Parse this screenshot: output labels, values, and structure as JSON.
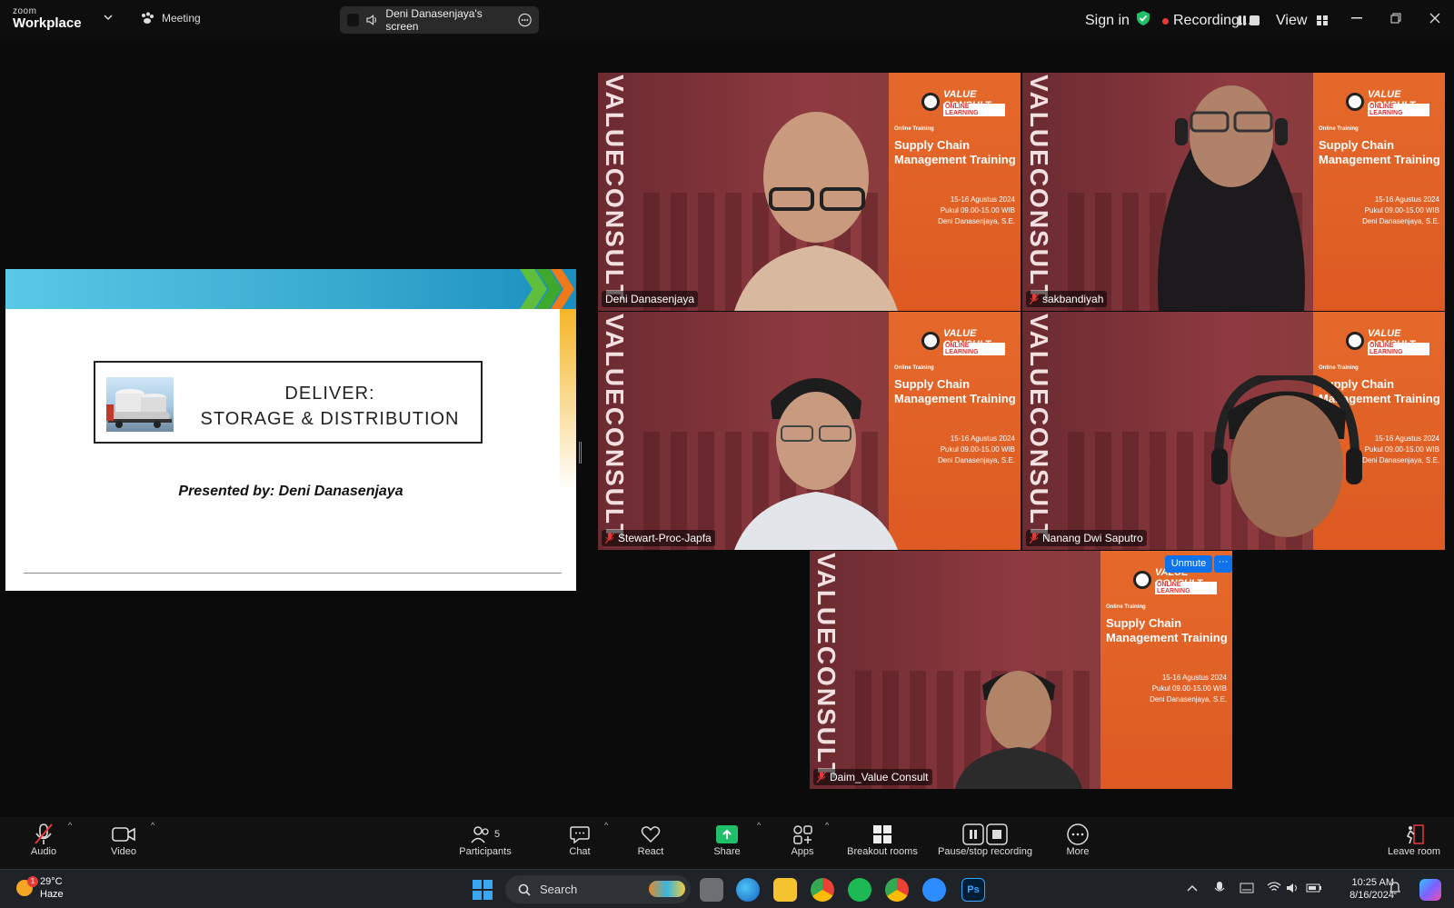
{
  "app": {
    "brand_small": "zoom",
    "brand_large": "Workplace",
    "meeting_label": "Meeting",
    "screen_share_label": "Deni Danasenjaya's screen"
  },
  "topbar_right": {
    "sign_in": "Sign in",
    "recording_label": "Recording...",
    "view_label": "View"
  },
  "slide": {
    "title_line1": "DELIVER:",
    "title_line2": "STORAGE & DISTRIBUTION",
    "presented_by": "Presented by: Deni Danasenjaya"
  },
  "tile_banner": {
    "logo_text": "VALUE CONSULT",
    "online_learning": "ONLINE LEARNING",
    "online_training": "Online Training",
    "title_line1": "Supply Chain",
    "title_line2": "Management Training",
    "date": "15-16 Agustus 2024",
    "time": "Pukul 09.00-15.00 WIB",
    "presenter": "Deni Danasenjaya, S.E.",
    "vertical_text": "VALUECONSULT"
  },
  "participants": [
    {
      "name": "Deni Danasenjaya",
      "muted": false,
      "active_speaker": true
    },
    {
      "name": "sakbandiyah",
      "muted": true,
      "active_speaker": false
    },
    {
      "name": "Stewart-Proc-Japfa",
      "muted": true,
      "active_speaker": false
    },
    {
      "name": "Nanang Dwi Saputro",
      "muted": true,
      "active_speaker": false
    },
    {
      "name": "Daim_Value Consult",
      "muted": true,
      "active_speaker": false
    }
  ],
  "tile_actions": {
    "unmute": "Unmute",
    "more": "···"
  },
  "toolbar": {
    "audio": "Audio",
    "video": "Video",
    "participants": "Participants",
    "participants_count": "5",
    "chat": "Chat",
    "react": "React",
    "share": "Share",
    "apps": "Apps",
    "breakout": "Breakout rooms",
    "pause_stop": "Pause/stop recording",
    "more": "More",
    "leave": "Leave room"
  },
  "taskbar": {
    "temperature": "29°C",
    "weather": "Haze",
    "weather_badge": "1",
    "search_placeholder": "Search",
    "time": "10:25 AM",
    "date": "8/16/2024"
  },
  "colors": {
    "active_speaker_border": "#32d296",
    "recording_dot": "#e53935",
    "share_green": "#20c06a",
    "unmute_blue": "#0e72ed",
    "banner_orange": "#e5692b"
  }
}
